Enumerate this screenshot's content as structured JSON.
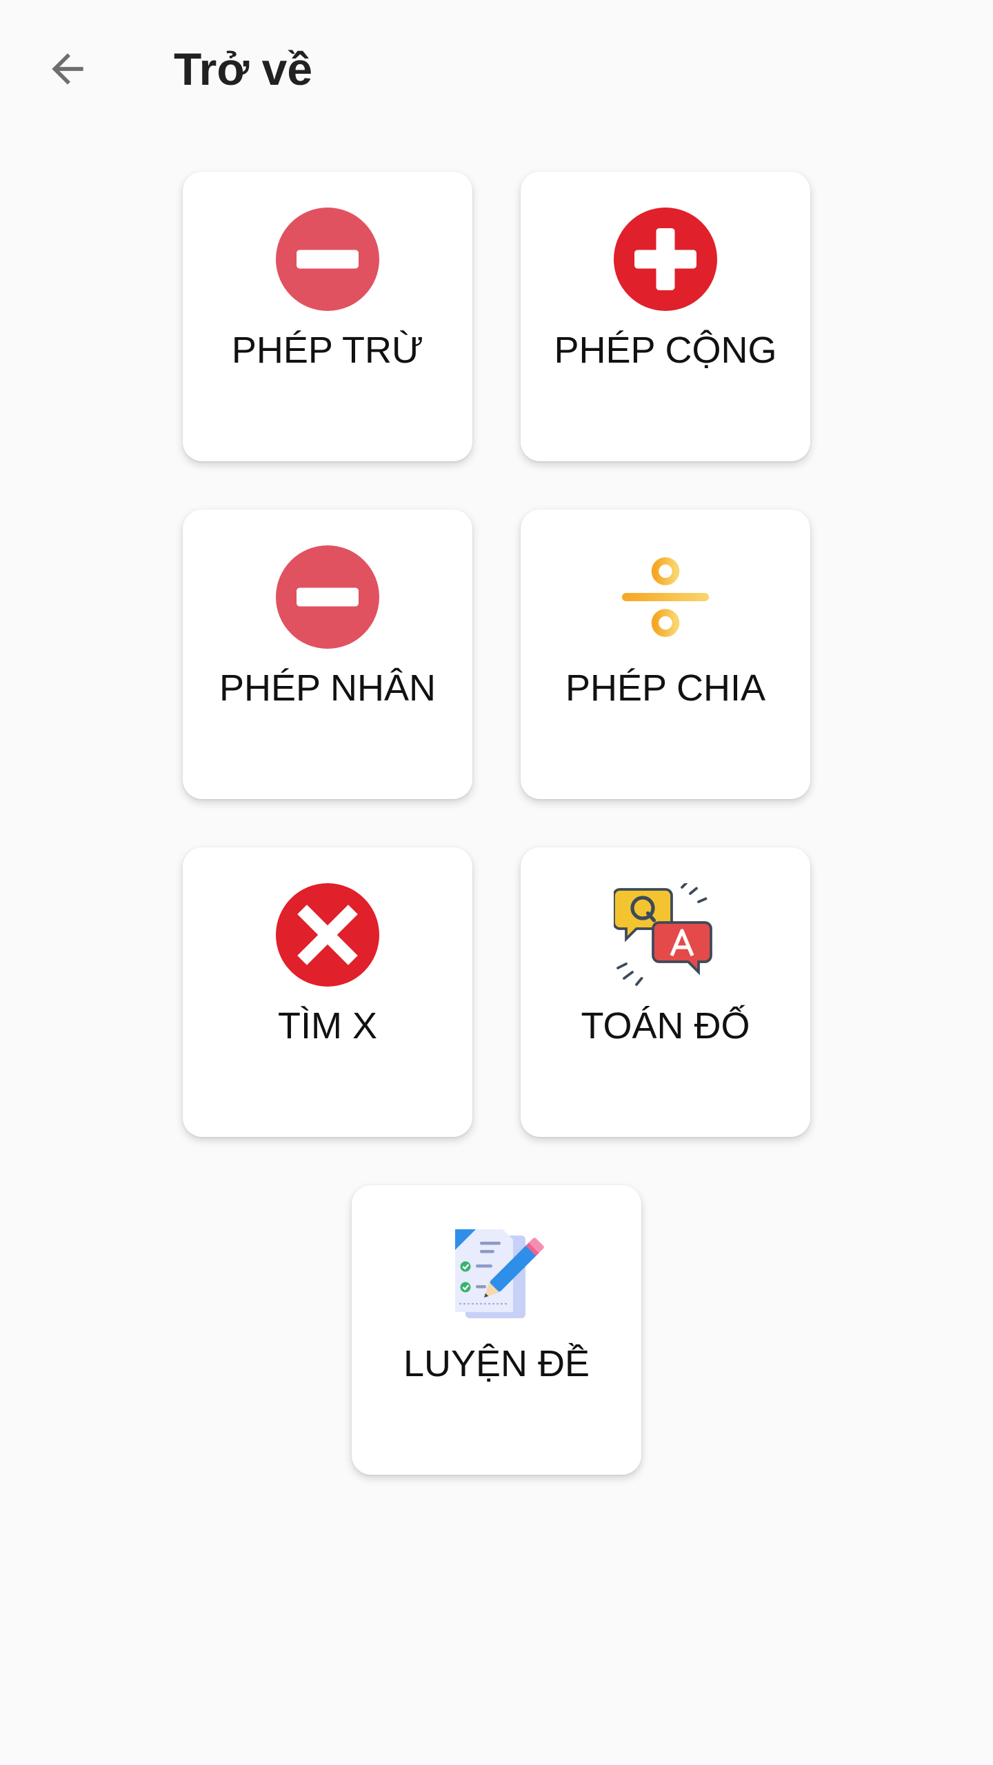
{
  "appbar": {
    "title": "Trở về",
    "back_icon": "arrow-back-icon"
  },
  "menu": {
    "items": [
      {
        "label": "PHÉP TRỪ",
        "icon": "minus-circle-icon",
        "color": "#e05260"
      },
      {
        "label": "PHÉP CỘNG",
        "icon": "plus-circle-icon",
        "color": "#e0202a"
      },
      {
        "label": "PHÉP NHÂN",
        "icon": "minus-circle-icon",
        "color": "#e05260"
      },
      {
        "label": "PHÉP CHIA",
        "icon": "divide-icon",
        "color": "#f6b73c"
      },
      {
        "label": "TÌM X",
        "icon": "x-circle-icon",
        "color": "#e0202a"
      },
      {
        "label": "TOÁN ĐỐ",
        "icon": "qa-speech-bubbles-icon",
        "color": "#f4c430"
      },
      {
        "label": "LUYỆN ĐỀ",
        "icon": "exam-document-pencil-icon",
        "color": "#2f8fe8"
      }
    ]
  }
}
